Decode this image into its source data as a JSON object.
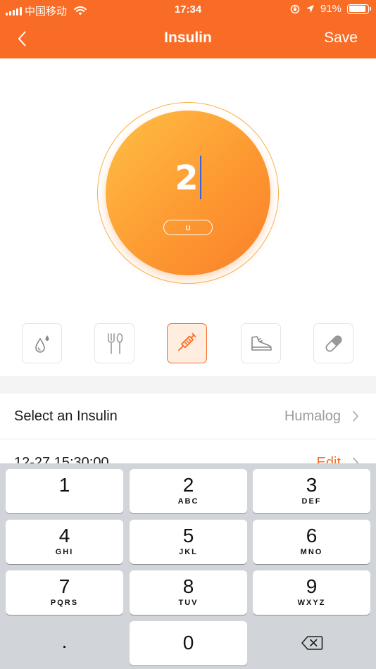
{
  "status_bar": {
    "carrier": "中国移动",
    "time": "17:34",
    "battery": "91%",
    "battery_level": 0.91
  },
  "nav": {
    "title": "Insulin",
    "save_label": "Save"
  },
  "dose": {
    "value": "2",
    "unit": "u"
  },
  "categories": [
    {
      "icon": "blood-drop-icon",
      "active": false
    },
    {
      "icon": "fork-spoon-icon",
      "active": false
    },
    {
      "icon": "syringe-icon",
      "active": true
    },
    {
      "icon": "sneaker-icon",
      "active": false
    },
    {
      "icon": "pill-icon",
      "active": false
    }
  ],
  "rows": {
    "insulin": {
      "label": "Select an Insulin",
      "value": "Humalog"
    },
    "time": {
      "label": "12-27 15:30:00",
      "value": "Edit"
    }
  },
  "keypad": {
    "keys": [
      {
        "digit": "1",
        "letters": ""
      },
      {
        "digit": "2",
        "letters": "ABC"
      },
      {
        "digit": "3",
        "letters": "DEF"
      },
      {
        "digit": "4",
        "letters": "GHI"
      },
      {
        "digit": "5",
        "letters": "JKL"
      },
      {
        "digit": "6",
        "letters": "MNO"
      },
      {
        "digit": "7",
        "letters": "PQRS"
      },
      {
        "digit": "8",
        "letters": "TUV"
      },
      {
        "digit": "9",
        "letters": "WXYZ"
      },
      {
        "digit": "0",
        "letters": ""
      }
    ],
    "decimal": "."
  },
  "colors": {
    "accent": "#f96c25",
    "circle_light": "#ffbf45",
    "circle_dark": "#fa7f28",
    "cursor": "#3a64d8"
  }
}
